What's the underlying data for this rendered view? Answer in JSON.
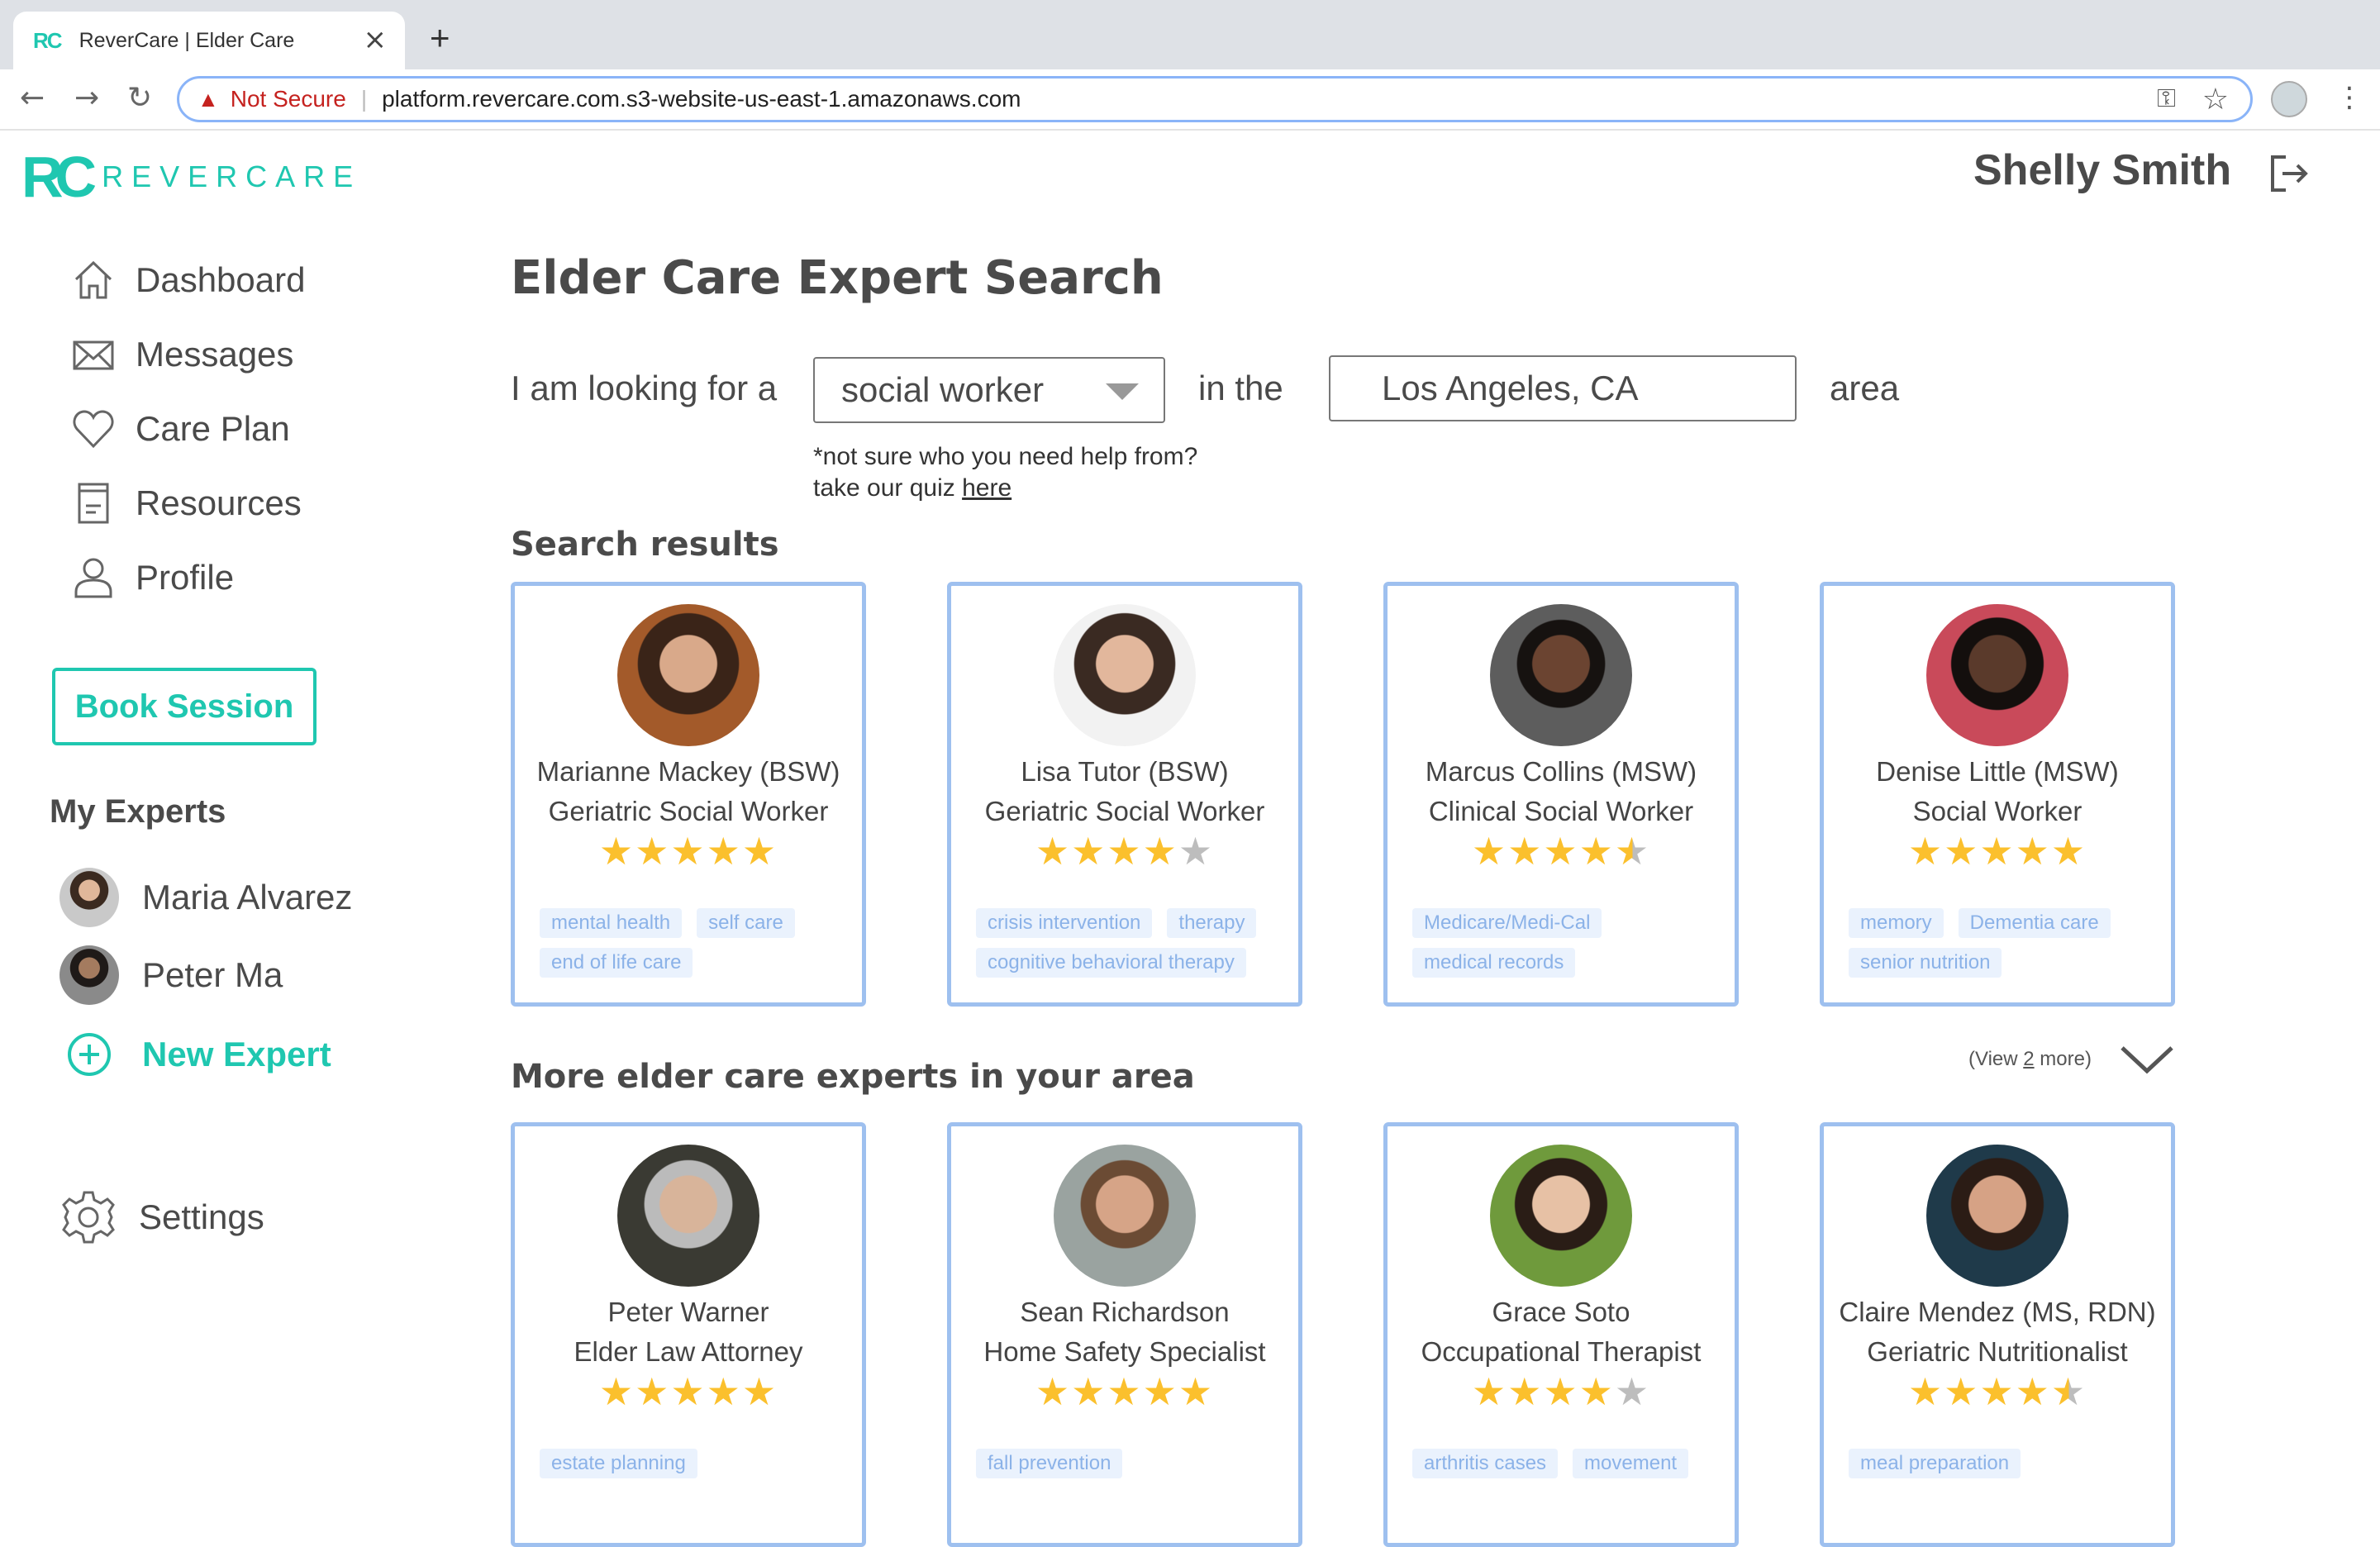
{
  "browser": {
    "tab_title": "ReverCare | Elder Care",
    "tab_favicon": "RC",
    "not_secure": "Not Secure",
    "url": "platform.revercare.com.s3-website-us-east-1.amazonaws.com"
  },
  "header": {
    "logo_mark": "RC",
    "logo_word": "REVERCARE",
    "user_name": "Shelly Smith"
  },
  "sidebar": {
    "items": [
      {
        "label": "Dashboard",
        "icon": "home-icon"
      },
      {
        "label": "Messages",
        "icon": "mail-icon"
      },
      {
        "label": "Care Plan",
        "icon": "heart-icon"
      },
      {
        "label": "Resources",
        "icon": "document-icon"
      },
      {
        "label": "Profile",
        "icon": "person-icon"
      }
    ],
    "book_session": "Book Session",
    "my_experts_title": "My Experts",
    "experts": [
      {
        "name": "Maria Alvarez"
      },
      {
        "name": "Peter Ma"
      }
    ],
    "new_expert": "New Expert",
    "settings": "Settings"
  },
  "search": {
    "title": "Elder Care Expert Search",
    "prefix": "I am looking for a",
    "role_value": "social worker",
    "middle": "in the",
    "location_value": "Los Angeles, CA",
    "suffix": "area",
    "note_line1": "*not sure who you need help from?",
    "note_line2": "take our quiz ",
    "note_link": "here"
  },
  "results": {
    "title": "Search results",
    "cards": [
      {
        "name": "Marianne Mackey (BSW)",
        "role": "Geriatric Social Worker",
        "rating": 5,
        "tags": [
          "mental health",
          "self care",
          "end of life care"
        ]
      },
      {
        "name": "Lisa Tutor (BSW)",
        "role": "Geriatric Social Worker",
        "rating": 4,
        "tags": [
          "crisis intervention",
          "therapy",
          "cognitive behavioral therapy"
        ]
      },
      {
        "name": "Marcus Collins (MSW)",
        "role": "Clinical Social Worker",
        "rating": 4.5,
        "tags": [
          "Medicare/Medi-Cal",
          "medical records"
        ]
      },
      {
        "name": "Denise Little (MSW)",
        "role": "Social Worker",
        "rating": 5,
        "tags": [
          "memory",
          "Dementia care",
          "senior nutrition"
        ]
      }
    ]
  },
  "more": {
    "title": "More elder care experts in your area",
    "view_more_prefix": "(View ",
    "view_more_count": "2",
    "view_more_suffix": " more)",
    "cards": [
      {
        "name": "Peter Warner",
        "role": "Elder Law Attorney",
        "rating": 5,
        "tags": [
          "estate planning"
        ]
      },
      {
        "name": "Sean Richardson",
        "role": "Home Safety Specialist",
        "rating": 5,
        "tags": [
          "fall prevention"
        ]
      },
      {
        "name": "Grace Soto",
        "role": "Occupational Therapist",
        "rating": 4,
        "tags": [
          "arthritis cases",
          "movement"
        ]
      },
      {
        "name": "Claire Mendez (MS, RDN)",
        "role": "Geriatric Nutritionalist",
        "rating": 4.5,
        "tags": [
          "meal preparation"
        ]
      }
    ]
  },
  "colors": {
    "accent": "#1fc7b0",
    "card_border": "#9ec0ef",
    "tag_bg": "#eaf2fd",
    "tag_text": "#8bb2e8",
    "star": "#fbc02d"
  }
}
